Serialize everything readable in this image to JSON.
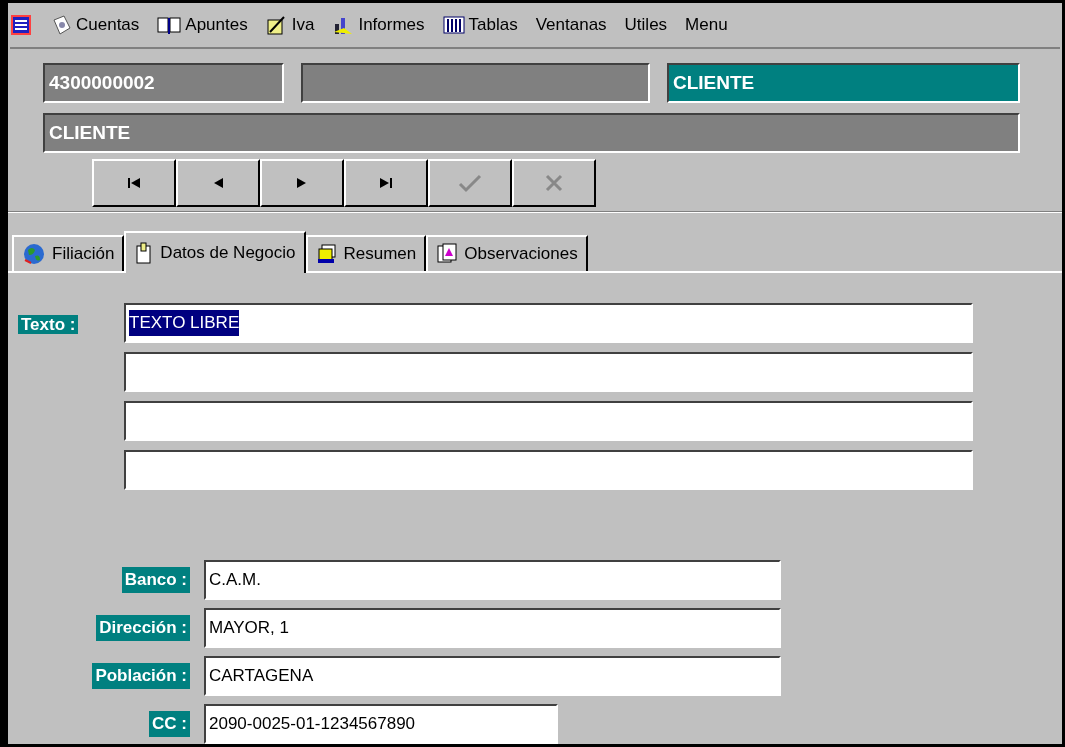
{
  "menu": [
    {
      "kind": "app"
    },
    {
      "kind": "accounts",
      "label": "Cuentas"
    },
    {
      "kind": "book",
      "label": "Apuntes"
    },
    {
      "kind": "pen",
      "label": "Iva"
    },
    {
      "kind": "chart",
      "label": "Informes"
    },
    {
      "kind": "table",
      "label": "Tablas"
    },
    {
      "kind": "none",
      "label": "Ventanas"
    },
    {
      "kind": "none",
      "label": "Utiles"
    },
    {
      "kind": "none",
      "label": "Menu"
    }
  ],
  "header": {
    "code": "4300000002",
    "name_short": "CLIENTE",
    "name_full": "CLIENTE"
  },
  "nav_buttons": [
    {
      "kind": "first",
      "disabled": false
    },
    {
      "kind": "prev",
      "disabled": false
    },
    {
      "kind": "next",
      "disabled": false
    },
    {
      "kind": "last",
      "disabled": false
    },
    {
      "kind": "confirm",
      "disabled": true
    },
    {
      "kind": "cancel",
      "disabled": true
    }
  ],
  "tabs": [
    {
      "kind": "globe",
      "label": "Filiación",
      "selected": false
    },
    {
      "kind": "clip",
      "label": "Datos de Negocio",
      "selected": true
    },
    {
      "kind": "stack",
      "label": "Resumen",
      "selected": false
    },
    {
      "kind": "doc",
      "label": "Observaciones",
      "selected": false
    }
  ],
  "texto": {
    "label": "Texto :",
    "value": "TEXTO LIBRE",
    "selected": true
  },
  "bank_fields": [
    {
      "label": "Banco :",
      "value": "C.A.M.",
      "kind": "wide"
    },
    {
      "label": "Dirección :",
      "value": "MAYOR, 1",
      "kind": "wide"
    },
    {
      "label": "Población :",
      "value": "CARTAGENA",
      "kind": "wide"
    },
    {
      "label": "CC :",
      "value": "2090-0025-01-1234567890",
      "kind": "narrow"
    }
  ]
}
